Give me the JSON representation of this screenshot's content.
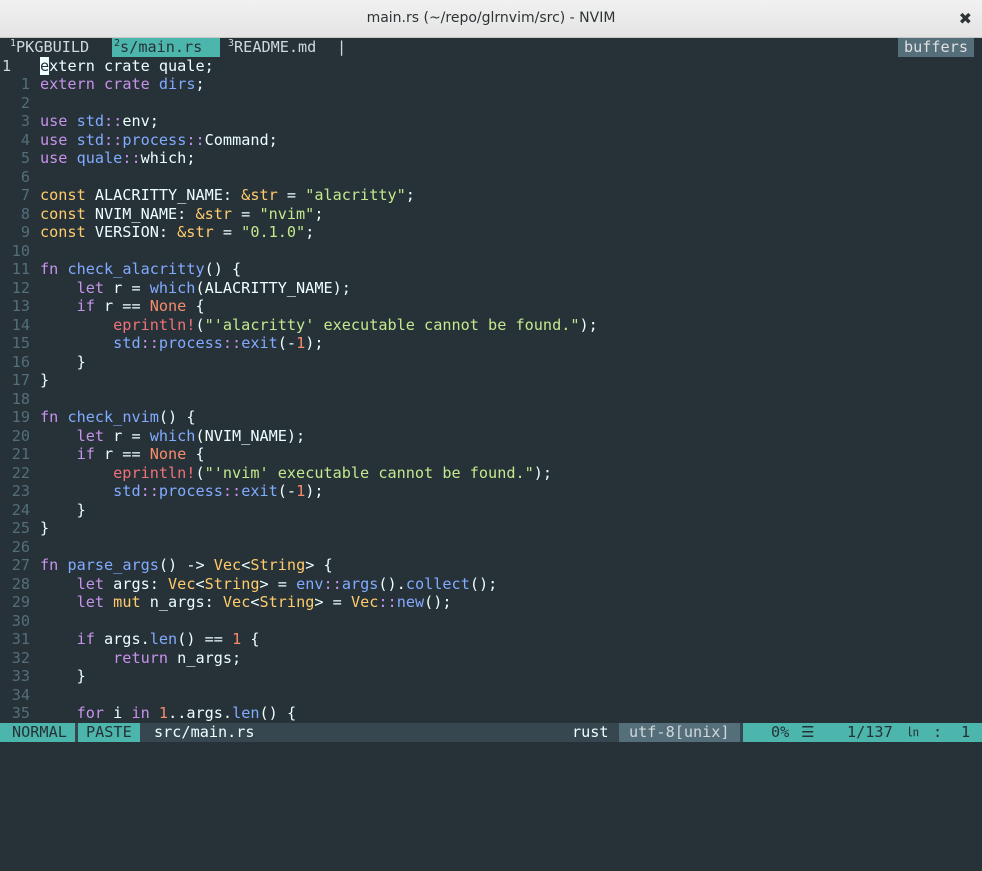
{
  "window": {
    "title": "main.rs (~/repo/glrnvim/src) - NVIM",
    "close_glyph": "✖"
  },
  "tabline": {
    "tabs": [
      {
        "num": "1",
        "label": "PKGBUILD",
        "active": false
      },
      {
        "num": "2",
        "label": "s/main.rs",
        "active": true
      },
      {
        "num": "3",
        "label": "README.md",
        "active": false
      }
    ],
    "separator": "|",
    "buffers_label": "buffers"
  },
  "editor": {
    "current_line_number": "1",
    "cursor_char": "e",
    "lines": [
      {
        "n": "",
        "html": "<span class='cursor'>e</span>xtern crate quale;"
      },
      {
        "n": "1",
        "html": "<span class='k'>extern</span> <span class='k'>crate</span> <span class='ns'>dirs</span>;"
      },
      {
        "n": "2",
        "html": ""
      },
      {
        "n": "3",
        "html": "<span class='k'>use</span> <span class='ns'>std</span><span class='k'>::</span>env;"
      },
      {
        "n": "4",
        "html": "<span class='k'>use</span> <span class='ns'>std</span><span class='k'>::</span><span class='ns'>process</span><span class='k'>::</span>Command;"
      },
      {
        "n": "5",
        "html": "<span class='k'>use</span> <span class='ns'>quale</span><span class='k'>::</span>which;"
      },
      {
        "n": "6",
        "html": ""
      },
      {
        "n": "7",
        "html": "<span class='k2'>const</span> ALACRITTY_NAME: <span class='k2'>&amp;str</span> = <span class='str'>\"alacritty\"</span>;"
      },
      {
        "n": "8",
        "html": "<span class='k2'>const</span> NVIM_NAME: <span class='k2'>&amp;str</span> = <span class='str'>\"nvim\"</span>;"
      },
      {
        "n": "9",
        "html": "<span class='k2'>const</span> VERSION: <span class='k2'>&amp;str</span> = <span class='str'>\"0.1.0\"</span>;"
      },
      {
        "n": "10",
        "html": ""
      },
      {
        "n": "11",
        "html": "<span class='k'>fn</span> <span class='fn'>check_alacritty</span>() {"
      },
      {
        "n": "12",
        "html": "    <span class='k'>let</span> r = <span class='fn'>which</span>(ALACRITTY_NAME);"
      },
      {
        "n": "13",
        "html": "    <span class='k'>if</span> r == <span class='num'>None</span> {"
      },
      {
        "n": "14",
        "html": "        <span class='mac'>eprintln!</span>(<span class='str'>\"'alacritty' executable cannot be found.\"</span>);"
      },
      {
        "n": "15",
        "html": "        <span class='ns'>std</span><span class='k'>::</span><span class='ns'>process</span><span class='k'>::</span><span class='fn'>exit</span>(-<span class='num'>1</span>);"
      },
      {
        "n": "16",
        "html": "    }"
      },
      {
        "n": "17",
        "html": "}"
      },
      {
        "n": "18",
        "html": ""
      },
      {
        "n": "19",
        "html": "<span class='k'>fn</span> <span class='fn'>check_nvim</span>() {"
      },
      {
        "n": "20",
        "html": "    <span class='k'>let</span> r = <span class='fn'>which</span>(NVIM_NAME);"
      },
      {
        "n": "21",
        "html": "    <span class='k'>if</span> r == <span class='num'>None</span> {"
      },
      {
        "n": "22",
        "html": "        <span class='mac'>eprintln!</span>(<span class='str'>\"'nvim' executable cannot be found.\"</span>);"
      },
      {
        "n": "23",
        "html": "        <span class='ns'>std</span><span class='k'>::</span><span class='ns'>process</span><span class='k'>::</span><span class='fn'>exit</span>(-<span class='num'>1</span>);"
      },
      {
        "n": "24",
        "html": "    }"
      },
      {
        "n": "25",
        "html": "}"
      },
      {
        "n": "26",
        "html": ""
      },
      {
        "n": "27",
        "html": "<span class='k'>fn</span> <span class='fn'>parse_args</span>() -&gt; <span class='ty'>Vec</span>&lt;<span class='ty'>String</span>&gt; {"
      },
      {
        "n": "28",
        "html": "    <span class='k'>let</span> args: <span class='ty'>Vec</span>&lt;<span class='ty'>String</span>&gt; = <span class='ns'>env</span><span class='k'>::</span><span class='fn'>args</span>().<span class='fn'>collect</span>();"
      },
      {
        "n": "29",
        "html": "    <span class='k'>let</span> <span class='k2'>mut</span> n_args: <span class='ty'>Vec</span>&lt;<span class='ty'>String</span>&gt; = <span class='ty'>Vec</span><span class='k'>::</span><span class='fn'>new</span>();"
      },
      {
        "n": "30",
        "html": ""
      },
      {
        "n": "31",
        "html": "    <span class='k'>if</span> args.<span class='fn'>len</span>() == <span class='num'>1</span> {"
      },
      {
        "n": "32",
        "html": "        <span class='k'>return</span> n_args;"
      },
      {
        "n": "33",
        "html": "    }"
      },
      {
        "n": "34",
        "html": ""
      },
      {
        "n": "35",
        "html": "    <span class='k'>for</span> i <span class='k'>in</span> <span class='num'>1</span>..args.<span class='fn'>len</span>() {"
      }
    ]
  },
  "statusline": {
    "mode": "NORMAL",
    "paste": "PASTE",
    "filename": "src/main.rs",
    "filetype": "rust",
    "encoding": "utf-8[unix]",
    "percent": "0%",
    "menu_glyph": "☰",
    "position": "1/137",
    "ln_label": "㏑",
    "colon": ":",
    "column": "1"
  },
  "colors": {
    "background": "#263238",
    "accent": "#4db6ac",
    "keyword": "#c792ea",
    "string": "#c3e88d",
    "type": "#ffcb6b"
  }
}
